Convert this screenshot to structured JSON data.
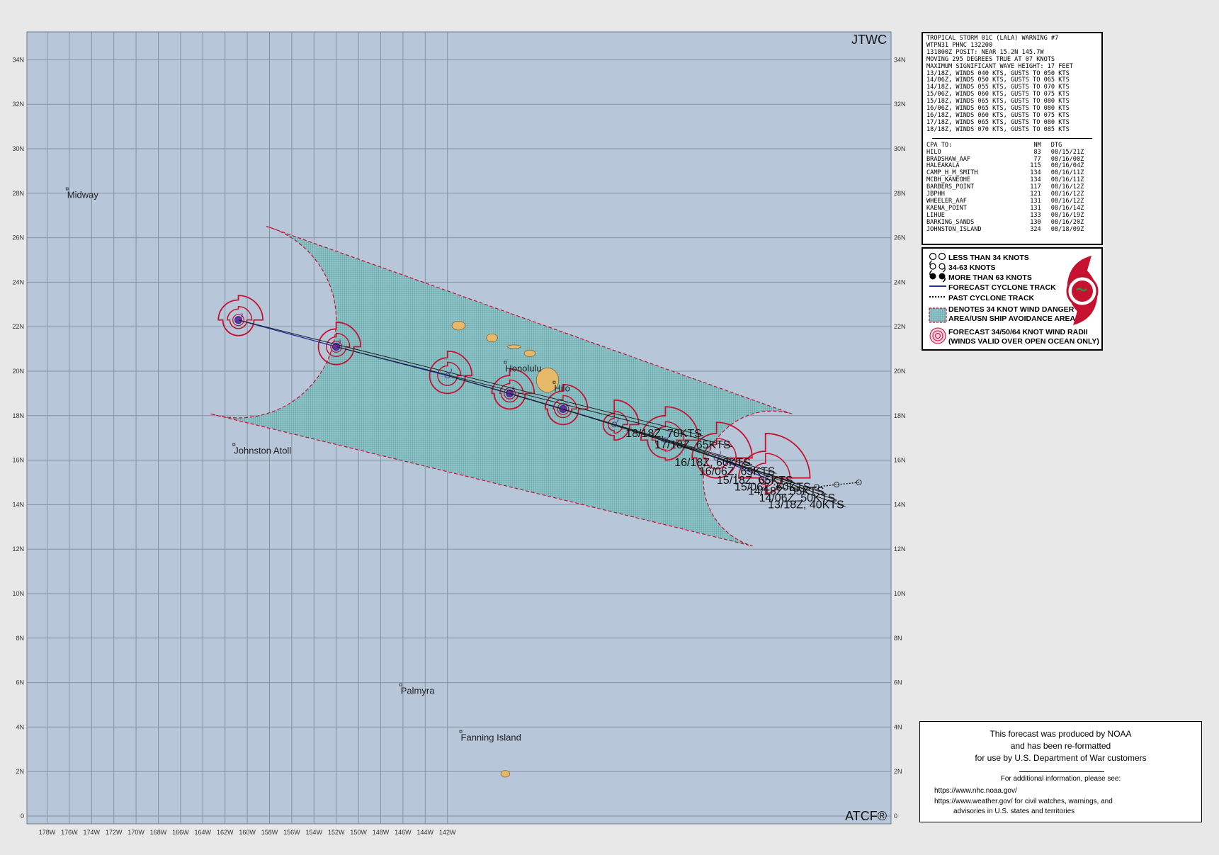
{
  "header": {
    "agency": "JTWC",
    "footer_mark": "ATCF®"
  },
  "axes": {
    "lat_labels": [
      "34N",
      "32N",
      "30N",
      "28N",
      "26N",
      "24N",
      "22N",
      "20N",
      "18N",
      "16N",
      "14N",
      "12N",
      "10N",
      "8N",
      "6N",
      "4N",
      "2N",
      "0"
    ],
    "lon_labels": [
      "178W",
      "176W",
      "174W",
      "172W",
      "170W",
      "168W",
      "166W",
      "164W",
      "162W",
      "160W",
      "158W",
      "156W",
      "154W",
      "152W",
      "150W",
      "148W",
      "146W",
      "144W",
      "142W"
    ]
  },
  "places": [
    {
      "name": "Midway",
      "lat": 28.2,
      "lon": -177.1
    },
    {
      "name": "Honolulu",
      "lat": 20.4,
      "lon": -157.4
    },
    {
      "name": "Hilo",
      "lat": 19.5,
      "lon": -155.2
    },
    {
      "name": "Johnston Atoll",
      "lat": 16.7,
      "lon": -169.6
    },
    {
      "name": "Palmyra",
      "lat": 5.9,
      "lon": -162.1
    },
    {
      "name": "Fanning Island",
      "lat": 3.8,
      "lon": -159.4
    }
  ],
  "islands": [
    {
      "name": "Kauai",
      "lat": 22.05,
      "lon": -159.5,
      "rx": 0.3,
      "ry": 0.2
    },
    {
      "name": "Oahu",
      "lat": 21.5,
      "lon": -158.0,
      "rx": 0.25,
      "ry": 0.18
    },
    {
      "name": "Molokai",
      "lat": 21.1,
      "lon": -157.0,
      "rx": 0.3,
      "ry": 0.08
    },
    {
      "name": "Maui",
      "lat": 20.8,
      "lon": -156.3,
      "rx": 0.25,
      "ry": 0.15
    },
    {
      "name": "Hawaii",
      "lat": 19.6,
      "lon": -155.5,
      "rx": 0.5,
      "ry": 0.55
    },
    {
      "name": "Kiritimati",
      "lat": 1.9,
      "lon": -157.4,
      "rx": 0.2,
      "ry": 0.15
    }
  ],
  "forecast_track": [
    {
      "label": "13/18Z,  40KTS",
      "lat": 15.2,
      "lon": -145.7,
      "intensity": "34-63"
    },
    {
      "label": "14/06Z,  50KTS",
      "lat": 16.1,
      "lon": -147.9,
      "intensity": "34-63"
    },
    {
      "label": "14/18Z,  55KTS",
      "lat": 16.9,
      "lon": -150.2,
      "intensity": "34-63"
    },
    {
      "label": "15/06Z,  60KTS",
      "lat": 17.6,
      "lon": -152.5,
      "intensity": "34-63"
    },
    {
      "label": "15/18Z,  65KTS",
      "lat": 18.3,
      "lon": -154.8,
      "intensity": ">63"
    },
    {
      "label": "16/06Z,  65KTS",
      "lat": 19.0,
      "lon": -157.2,
      "intensity": ">63"
    },
    {
      "label": "16/18Z,  60KTS",
      "lat": 19.8,
      "lon": -160.0,
      "intensity": "34-63"
    },
    {
      "label": "17/18Z,  65KTS",
      "lat": 21.1,
      "lon": -165.0,
      "intensity": ">63"
    },
    {
      "label": "18/18Z,  70KTS",
      "lat": 22.3,
      "lon": -169.4,
      "intensity": ">63"
    }
  ],
  "past_track": [
    {
      "lat": 15.0,
      "lon": -141.5
    },
    {
      "lat": 14.9,
      "lon": -142.5
    },
    {
      "lat": 14.8,
      "lon": -143.4
    },
    {
      "lat": 14.7,
      "lon": -144.3
    },
    {
      "lat": 14.75,
      "lon": -145.1
    }
  ],
  "callouts": [
    {
      "text_lat": 13.9,
      "text_lon": -142.1,
      "point": 0
    },
    {
      "text_lat": 14.2,
      "text_lon": -142.5,
      "point": 1
    },
    {
      "text_lat": 14.5,
      "text_lon": -143.0,
      "point": 2
    },
    {
      "text_lat": 14.7,
      "text_lon": -143.6,
      "point": 3
    },
    {
      "text_lat": 15.0,
      "text_lon": -144.4,
      "point": 4
    },
    {
      "text_lat": 15.4,
      "text_lon": -145.2,
      "point": 5
    },
    {
      "text_lat": 15.8,
      "text_lon": -146.3,
      "point": 6
    },
    {
      "text_lat": 16.6,
      "text_lon": -147.2,
      "point": 7
    },
    {
      "text_lat": 17.1,
      "text_lon": -148.5,
      "point": 8
    }
  ],
  "wind_radii_km": [
    {
      "point": 0,
      "ne": 2.0,
      "se": 0.7,
      "sw": 0.3,
      "nw": 1.2
    },
    {
      "point": 1,
      "ne": 1.6,
      "se": 0.9,
      "sw": 0.9,
      "nw": 1.1
    },
    {
      "point": 2,
      "ne": 1.5,
      "se": 0.9,
      "sw": 0.8,
      "nw": 1.1
    },
    {
      "point": 3,
      "ne": 1.1,
      "se": 0.7,
      "sw": 0.5,
      "nw": 0.5
    },
    {
      "point": 4,
      "ne": 1.1,
      "se": 0.7,
      "sw": 0.7,
      "nw": 0.8
    },
    {
      "point": 5,
      "ne": 1.1,
      "se": 0.7,
      "sw": 0.7,
      "nw": 0.8
    },
    {
      "point": 6,
      "ne": 1.1,
      "se": 0.8,
      "sw": 0.8,
      "nw": 0.8
    },
    {
      "point": 7,
      "ne": 1.1,
      "se": 0.8,
      "sw": 0.8,
      "nw": 0.8
    },
    {
      "point": 8,
      "ne": 1.1,
      "se": 0.7,
      "sw": 0.7,
      "nw": 0.9
    }
  ],
  "warning": {
    "lines": [
      "TROPICAL STORM 01C (LALA) WARNING #7",
      "WTPN31 PHNC 132200",
      "131800Z POSIT: NEAR 15.2N 145.7W",
      "MOVING 295 DEGREES TRUE AT 07 KNOTS",
      "MAXIMUM SIGNIFICANT WAVE HEIGHT: 17 FEET",
      "13/18Z, WINDS 040 KTS, GUSTS TO 050 KTS",
      "14/06Z, WINDS 050 KTS, GUSTS TO 065 KTS",
      "14/18Z, WINDS 055 KTS, GUSTS TO 070 KTS",
      "15/06Z, WINDS 060 KTS, GUSTS TO 075 KTS",
      "15/18Z, WINDS 065 KTS, GUSTS TO 080 KTS",
      "16/06Z, WINDS 065 KTS, GUSTS TO 080 KTS",
      "16/18Z, WINDS 060 KTS, GUSTS TO 075 KTS",
      "17/18Z, WINDS 065 KTS, GUSTS TO 080 KTS",
      "18/18Z, WINDS 070 KTS, GUSTS TO 085 KTS"
    ],
    "cpa_header": {
      "col1": "CPA TO:",
      "col2": "NM",
      "col3": "DTG"
    },
    "cpa_rows": [
      [
        "HILO",
        "83",
        "08/15/21Z"
      ],
      [
        "BRADSHAW_AAF",
        "77",
        "08/16/00Z"
      ],
      [
        "HALEAKALA",
        "115",
        "08/16/04Z"
      ],
      [
        "CAMP_H_M_SMITH",
        "134",
        "08/16/11Z"
      ],
      [
        "MCBH_KANEOHE",
        "134",
        "08/16/11Z"
      ],
      [
        "BARBERS_POINT",
        "117",
        "08/16/12Z"
      ],
      [
        "JBPHH",
        "121",
        "08/16/12Z"
      ],
      [
        "WHEELER_AAF",
        "131",
        "08/16/12Z"
      ],
      [
        "KAENA_POINT",
        "131",
        "08/16/14Z"
      ],
      [
        "LIHUE",
        "133",
        "08/16/19Z"
      ],
      [
        "BARKING_SANDS",
        "130",
        "08/16/20Z"
      ],
      [
        "JOHNSTON_ISLAND",
        "324",
        "08/18/09Z"
      ]
    ]
  },
  "legend": {
    "items": [
      "LESS THAN 34 KNOTS",
      "34-63 KNOTS",
      "MORE THAN 63 KNOTS",
      "FORECAST CYCLONE TRACK",
      "PAST CYCLONE TRACK",
      "DENOTES 34 KNOT WIND DANGER",
      "AREA/USN SHIP AVOIDANCE AREA",
      "FORECAST 34/50/64 KNOT WIND RADII",
      "(WINDS VALID OVER OPEN OCEAN ONLY)"
    ],
    "colors": {
      "track": "#1f2f9e",
      "radii": "#c41230",
      "danger_fill": "#8ec3c7",
      "ocean": "#b7c6d8",
      "land": "#e8b86a"
    }
  },
  "info": {
    "lines": [
      "This forecast was produced by NOAA",
      "and has been re-formatted",
      "for use by U.S. Department of War customers"
    ],
    "sub": "For additional information, please see:",
    "link1": "https://www.nhc.noaa.gov/",
    "link2": "https://www.weather.gov/ for civil watches, warnings, and",
    "link3": "advisories in U.S. states and territories"
  }
}
